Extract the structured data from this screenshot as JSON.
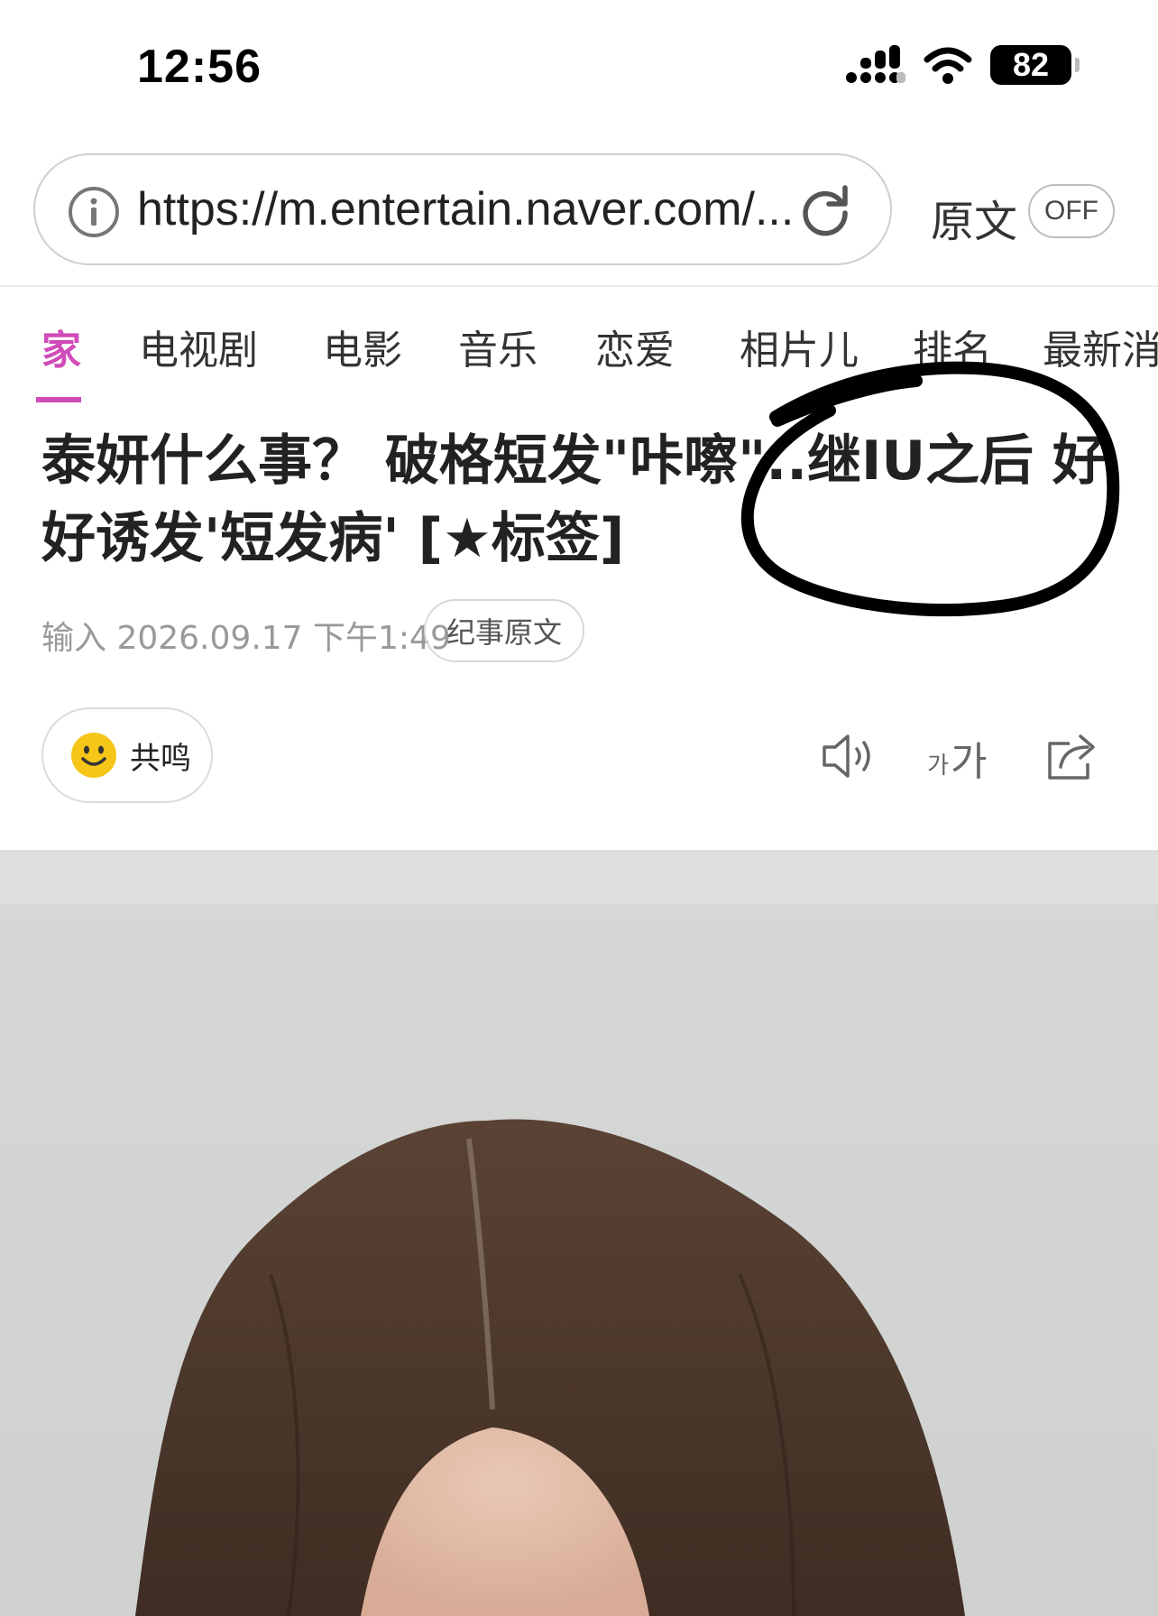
{
  "status_bar": {
    "time": "12:56",
    "battery": "82"
  },
  "browser": {
    "url": "https://m.entertain.naver.com/...",
    "original_label": "原文",
    "toggle_label": "OFF"
  },
  "tabs": [
    {
      "label": "家",
      "active": true
    },
    {
      "label": "电视剧"
    },
    {
      "label": "电影"
    },
    {
      "label": "音乐"
    },
    {
      "label": "恋爱"
    },
    {
      "label": "相片儿"
    },
    {
      "label": "排名"
    },
    {
      "label": "最新消"
    }
  ],
  "article": {
    "headline_line1": "泰妍什么事？ 破格短发\"咔嚓\"..继IU之后 好",
    "headline_line2": "好诱发'短发病' [★标签]",
    "date": "输入 2026.09.17 下午1:49",
    "original_chip": "纪事原文"
  },
  "actions": {
    "empathy_label": "共鸣",
    "font_small": "가",
    "font_big": "가"
  },
  "colors": {
    "accent": "#d04bb8",
    "empathy_emoji": "#f5c518"
  },
  "icons": [
    "info-icon",
    "reload-icon",
    "smiley-icon",
    "speaker-icon",
    "font-size-icon",
    "share-icon"
  ]
}
